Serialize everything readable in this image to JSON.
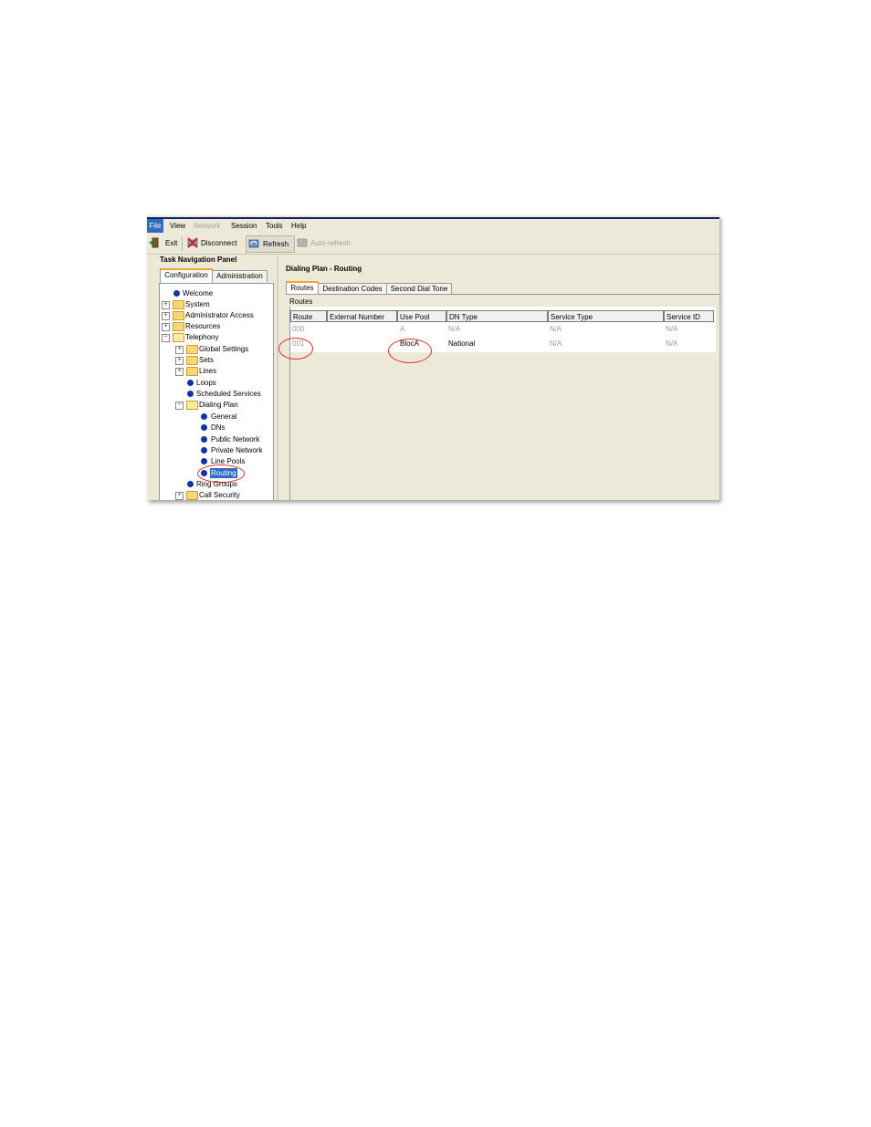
{
  "menu": {
    "items": [
      "File",
      "View",
      "Network",
      "Session",
      "Tools",
      "Help"
    ]
  },
  "toolbar": {
    "exit": "Exit",
    "disconnect": "Disconnect",
    "refresh": "Refresh",
    "auto_refresh": "Auto-refresh"
  },
  "nav": {
    "title": "Task Navigation Panel",
    "tabs": [
      "Configuration",
      "Administration"
    ],
    "tree": [
      {
        "label": "Welcome"
      },
      {
        "label": "System"
      },
      {
        "label": "Administrator Access"
      },
      {
        "label": "Resources"
      },
      {
        "label": "Telephony"
      },
      {
        "label": "Global Settings"
      },
      {
        "label": "Sets"
      },
      {
        "label": "Lines"
      },
      {
        "label": "Loops"
      },
      {
        "label": "Scheduled Services"
      },
      {
        "label": "Dialing Plan"
      },
      {
        "label": "General"
      },
      {
        "label": "DNs"
      },
      {
        "label": "Public Network"
      },
      {
        "label": "Private Network"
      },
      {
        "label": "Line Pools"
      },
      {
        "label": "Routing"
      },
      {
        "label": "Ring Groups"
      },
      {
        "label": "Call Security"
      }
    ]
  },
  "main": {
    "title": "Dialing Plan - Routing",
    "tabs": [
      "Routes",
      "Destination Codes",
      "Second Dial Tone"
    ],
    "section_label": "Routes",
    "columns": [
      "Route",
      "External Number",
      "Use Pool",
      "DN Type",
      "Service Type",
      "Service ID"
    ],
    "rows": [
      [
        "000",
        "",
        "A",
        "N/A",
        "N/A",
        "N/A"
      ],
      [
        "001",
        "",
        "BlocA",
        "National",
        "N/A",
        "N/A"
      ]
    ]
  },
  "colors": {
    "window_bg": "#ece9d8",
    "selection": "#316ac5",
    "highlight_ring": "#e03030",
    "tab_accent": "#f5a623"
  }
}
